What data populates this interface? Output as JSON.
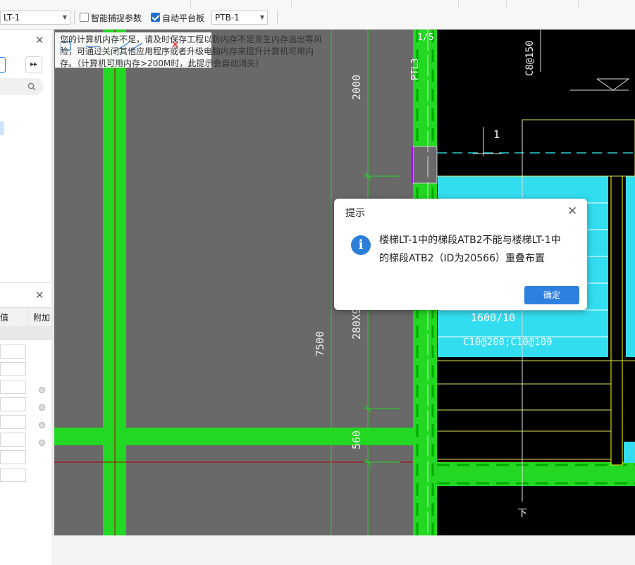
{
  "toolbar": {
    "stair_select": "LT-1",
    "smart_snap_label": "智能捕捉参数",
    "smart_snap_checked": false,
    "auto_platform_label": "自动平台板",
    "auto_platform_checked": true,
    "platform_select": "PTB-1"
  },
  "left_panel": {
    "props_col_value": "值",
    "props_col_extra": "附加"
  },
  "memory_notice": {
    "line1": "您的计算机内存不足，请及时保存工程以防内存不足发生内存溢出等风",
    "line2": "险，可通过关闭其他应用程序或者升级电脑内存来提升计算机可用内",
    "line3": "存。（计算机可用内存>200M时，此提示会自动消失）"
  },
  "drawing": {
    "axis_label": "1/5",
    "beam_label": "PTL3",
    "rebar_top": "C8@150",
    "dim_2000": "2000",
    "dim_280x9": "280X9",
    "dim_7500": "7500",
    "dim_560": "560",
    "step_1": "1",
    "slab_label_1": "1600/10",
    "slab_label_2": "C10@200;C10@100",
    "down_label": "下"
  },
  "dialog": {
    "title": "提示",
    "message_line1": "楼梯LT-1中的梯段ATB2不能与楼梯LT-1中",
    "message_line2": "的梯段ATB2（ID为20566）重叠布置",
    "ok_label": "确定",
    "icon": "info-icon"
  },
  "colors": {
    "canvas_bg": "#696969",
    "cad_black": "#000000",
    "green": "#22d822",
    "cyan": "#33ddf0",
    "accent": "#2e80e0"
  }
}
